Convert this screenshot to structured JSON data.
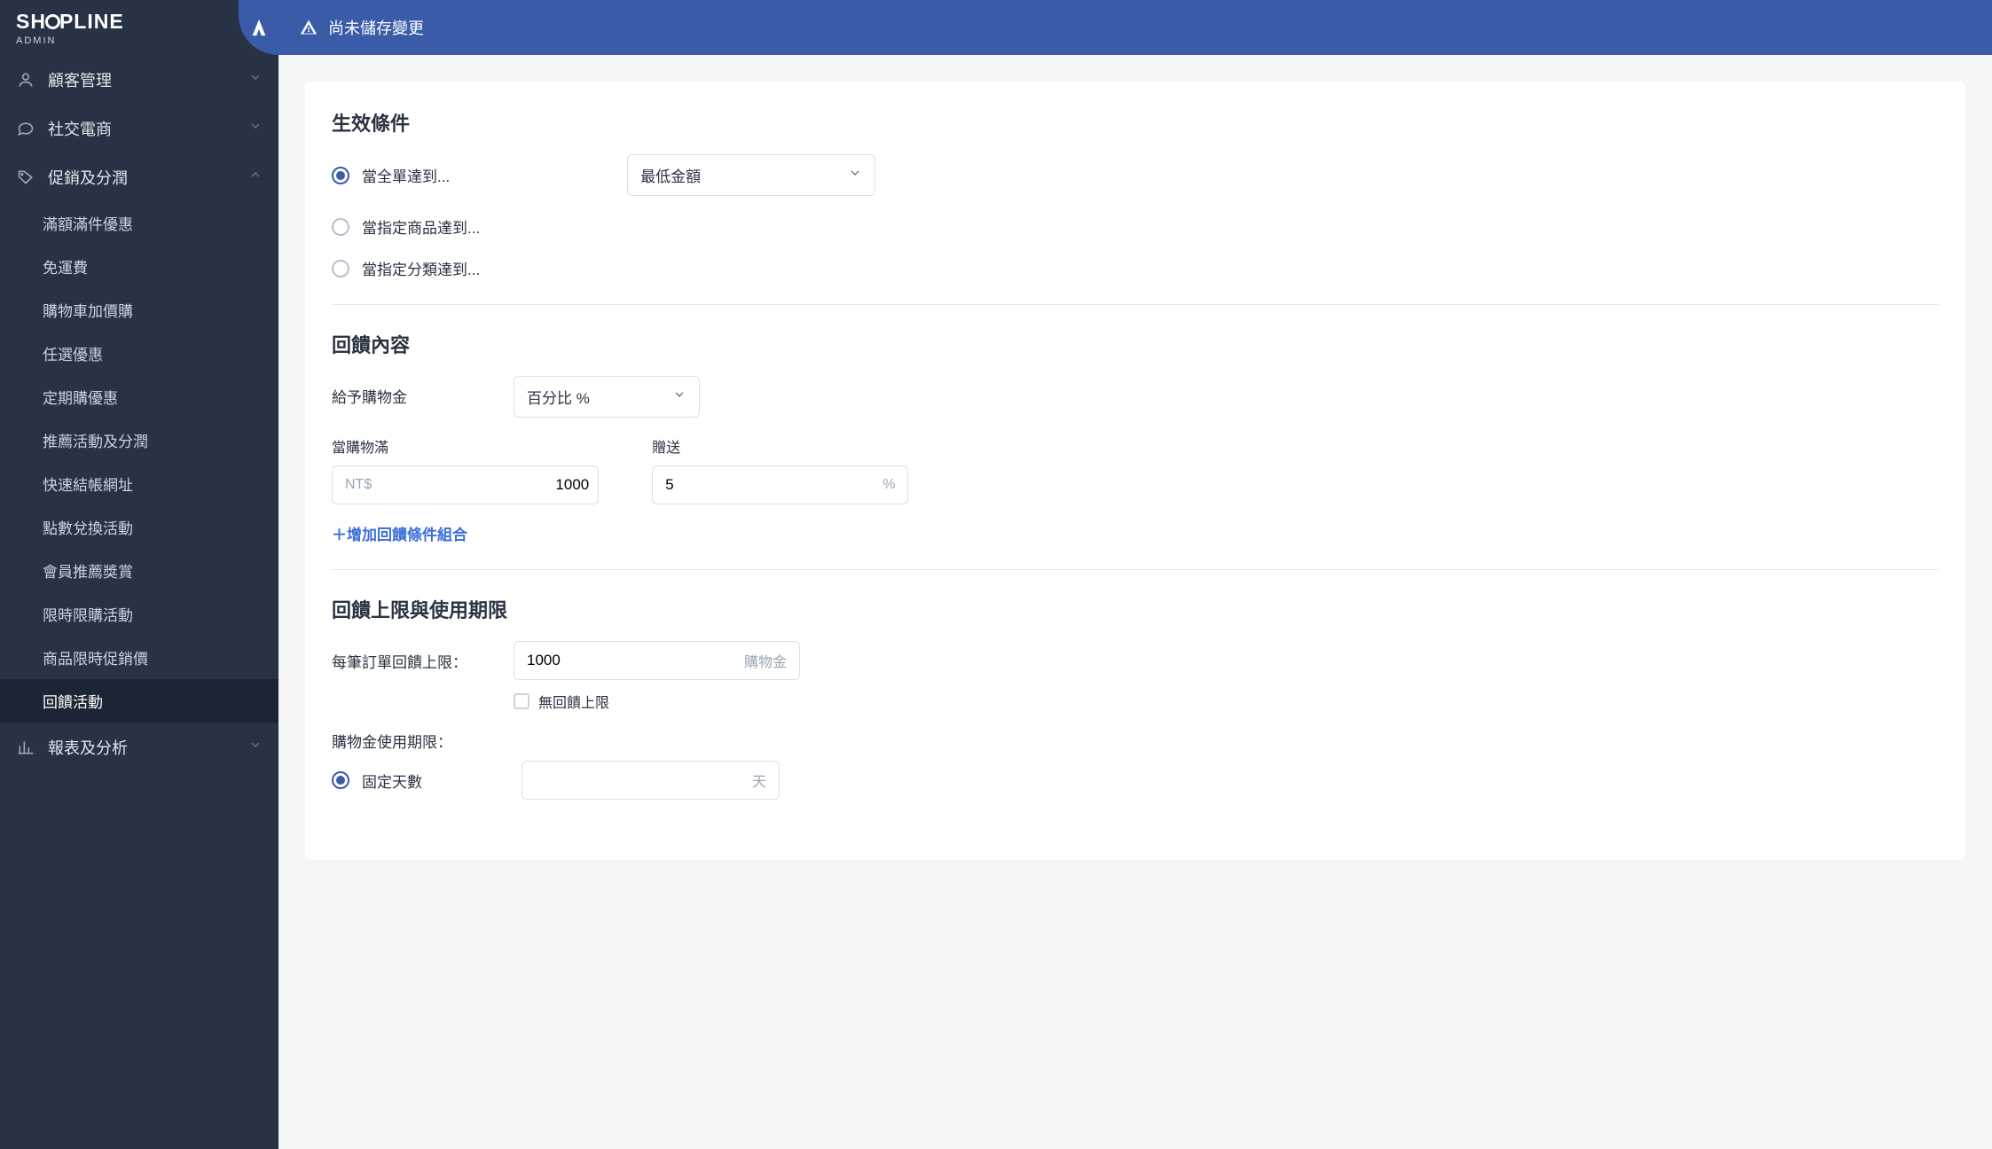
{
  "logo": {
    "brand": "SHOPLINE",
    "sub": "ADMIN"
  },
  "topbar": {
    "warning": "尚未儲存變更"
  },
  "nav": {
    "sections": [
      {
        "label": "顧客管理",
        "icon": "user"
      },
      {
        "label": "社交電商",
        "icon": "chat"
      },
      {
        "label": "促銷及分潤",
        "icon": "tag",
        "expanded": true
      },
      {
        "label": "報表及分析",
        "icon": "chart"
      }
    ],
    "promo_items": [
      "滿額滿件優惠",
      "免運費",
      "購物車加價購",
      "任選優惠",
      "定期購優惠",
      "推薦活動及分潤",
      "快速結帳網址",
      "點數兌換活動",
      "會員推薦獎賞",
      "限時限購活動",
      "商品限時促銷價",
      "回饋活動"
    ],
    "active_item": "回饋活動"
  },
  "form": {
    "section1_title": "生效條件",
    "conditions": [
      "當全單達到...",
      "當指定商品達到...",
      "當指定分類達到..."
    ],
    "condition_selected": 0,
    "condition_type_selected": "最低金額",
    "section2_title": "回饋內容",
    "credit_label": "給予購物金",
    "credit_type_selected": "百分比 %",
    "threshold_label": "當購物滿",
    "threshold_currency": "NT$",
    "threshold_value": "1000",
    "reward_label": "贈送",
    "reward_value": "5",
    "reward_unit": "%",
    "add_combo": "＋增加回饋條件組合",
    "section3_title": "回饋上限與使用期限",
    "cap_label": "每筆訂單回饋上限：",
    "cap_value": "1000",
    "cap_unit": "購物金",
    "no_cap_label": "無回饋上限",
    "validity_label": "購物金使用期限：",
    "validity_options": [
      "固定天數"
    ],
    "validity_selected": 0,
    "validity_unit": "天"
  }
}
